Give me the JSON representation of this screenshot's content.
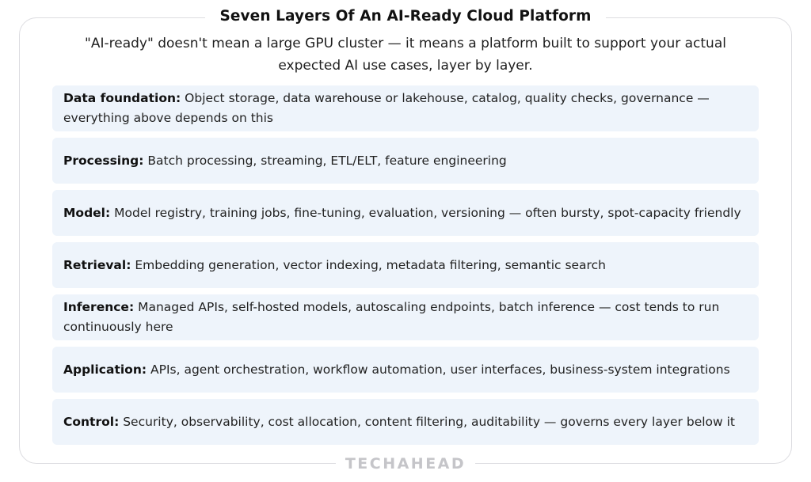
{
  "title": "Seven Layers Of An AI-Ready Cloud Platform",
  "subtitle": "\"AI-ready\" doesn't mean a large GPU cluster — it means a platform built to support your actual expected AI use cases, layer by layer.",
  "layers": [
    {
      "name": "Data foundation:",
      "description": "Object storage, data warehouse or lakehouse, catalog, quality checks, governance — everything above depends on this"
    },
    {
      "name": "Processing:",
      "description": "Batch processing, streaming, ETL/ELT, feature engineering"
    },
    {
      "name": "Model:",
      "description": "Model registry, training jobs, fine-tuning, evaluation, versioning — often bursty, spot-capacity friendly"
    },
    {
      "name": "Retrieval:",
      "description": "Embedding generation, vector indexing, metadata filtering, semantic search"
    },
    {
      "name": "Inference:",
      "description": "Managed APIs, self-hosted models, autoscaling endpoints, batch inference — cost tends to run continuously here"
    },
    {
      "name": "Application:",
      "description": "APIs, agent orchestration, workflow automation, user interfaces, business-system integrations"
    },
    {
      "name": "Control:",
      "description": "Security, observability, cost allocation, content filtering, auditability — governs every layer below it"
    }
  ],
  "brand": "TECHAHEAD",
  "colors": {
    "layer_background": "#eef4fb",
    "frame_border": "#dcdce0",
    "brand_text": "#c5c5c9"
  }
}
